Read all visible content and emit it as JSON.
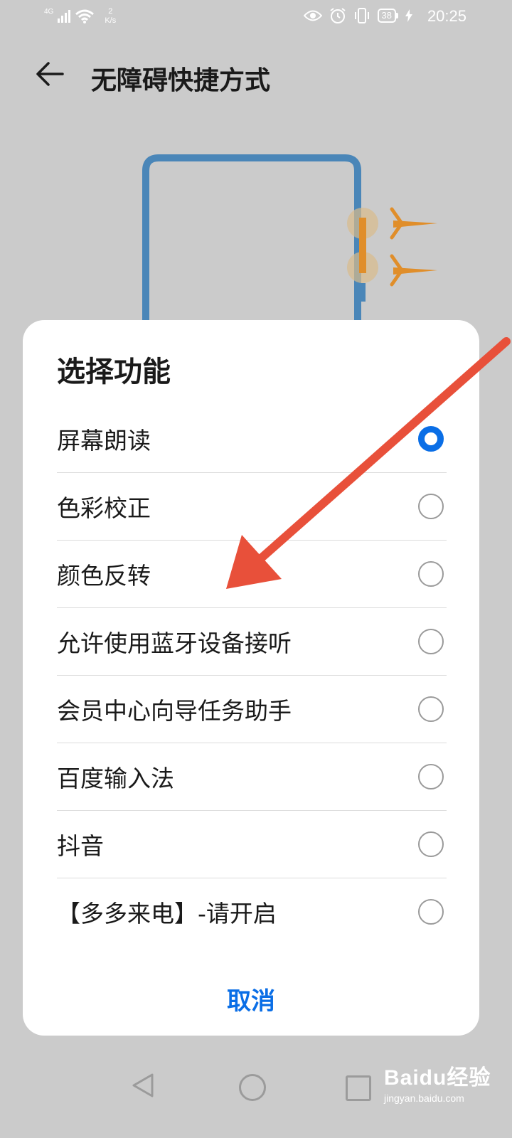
{
  "status_bar": {
    "network": "4G",
    "speed_value": "2",
    "speed_unit": "K/s",
    "battery": "38",
    "time": "20:25"
  },
  "header": {
    "title": "无障碍快捷方式"
  },
  "dialog": {
    "title": "选择功能",
    "options": [
      {
        "label": "屏幕朗读",
        "selected": true
      },
      {
        "label": "色彩校正",
        "selected": false
      },
      {
        "label": "颜色反转",
        "selected": false
      },
      {
        "label": "允许使用蓝牙设备接听",
        "selected": false
      },
      {
        "label": "会员中心向导任务助手",
        "selected": false
      },
      {
        "label": "百度输入法",
        "selected": false
      },
      {
        "label": "抖音",
        "selected": false
      },
      {
        "label": "【多多来电】-请开启",
        "selected": false
      }
    ],
    "cancel_label": "取消"
  },
  "watermark": {
    "main": "Baidu经验",
    "sub": "jingyan.baidu.com"
  },
  "colors": {
    "accent": "#0a6ee6",
    "annotation_arrow": "#e8503a",
    "phone_outline": "#4a86b8"
  }
}
